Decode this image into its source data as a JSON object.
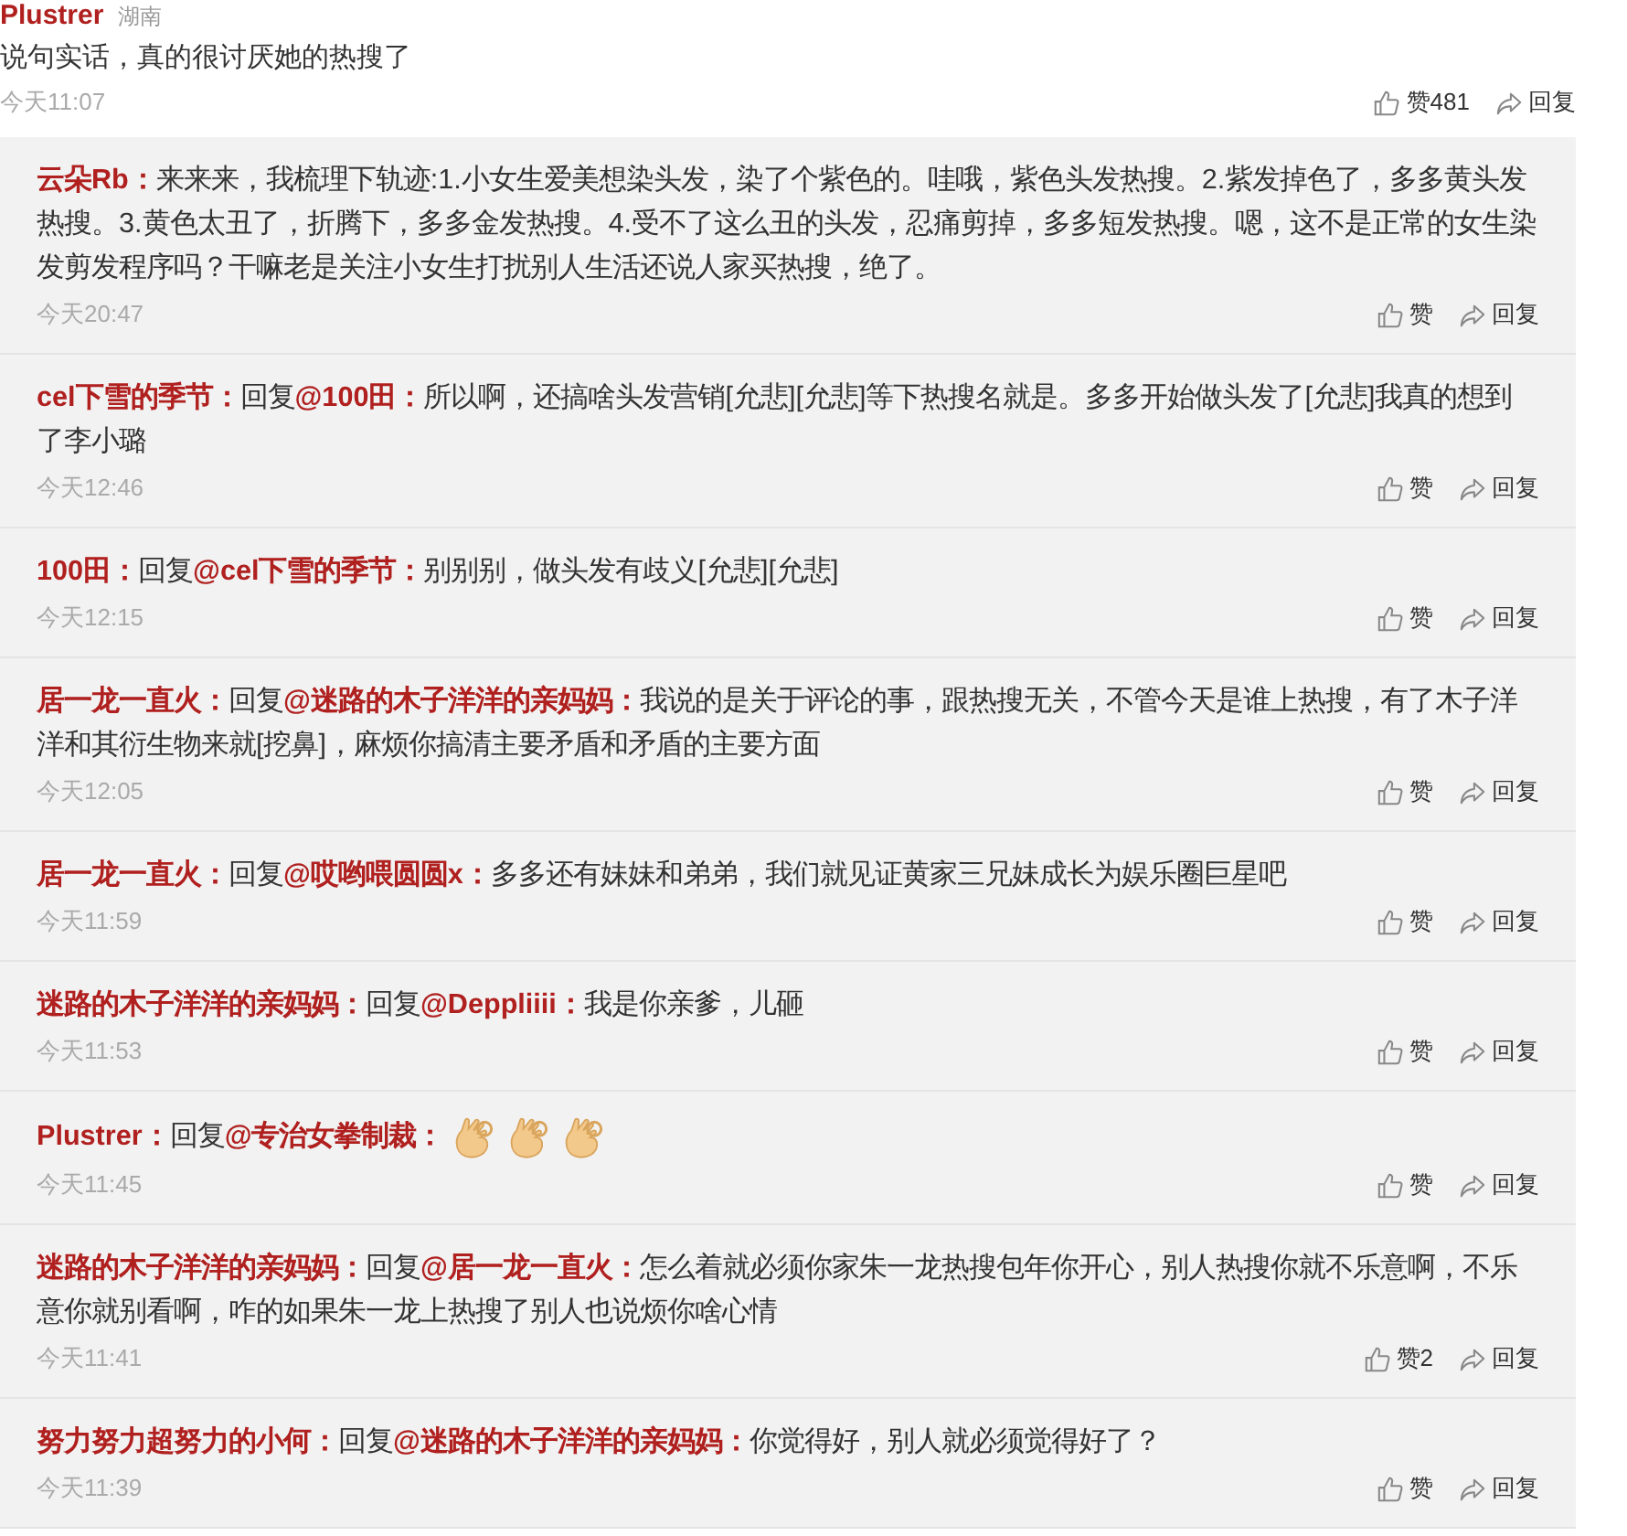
{
  "main_comment": {
    "author": "Plustrer",
    "location": "湖南",
    "text": "说句实话，真的很讨厌她的热搜了",
    "time": "今天11:07",
    "like_label": "赞481",
    "reply_label": "回复"
  },
  "replies": [
    {
      "text": "**云朵Rb：**来来来，我梳理下轨迹:1.小女生爱美想染头发，染了个紫色的。哇哦，紫色头发热搜。2.紫发掉色了，多多黄头发热搜。3.黄色太丑了，折腾下，多多金发热搜。4.受不了这么丑的头发，忍痛剪掉，多多短发热搜。嗯，这不是正常的女生染发剪发程序吗？干嘛老是关注小女生打扰别人生活还说人家买热搜，绝了。",
      "time": "今天20:47",
      "like_label": "赞",
      "reply_label": "回复"
    },
    {
      "text": "**cel下雪的季节：**回复**@100田：**所以啊，还搞啥头发营销[允悲][允悲]等下热搜名就是。多多开始做头发了[允悲]我真的想到了李小璐",
      "time": "今天12:46",
      "like_label": "赞",
      "reply_label": "回复"
    },
    {
      "text": "**100田：**回复**@cel下雪的季节：**别别别，做头发有歧义[允悲][允悲]",
      "time": "今天12:15",
      "like_label": "赞",
      "reply_label": "回复"
    },
    {
      "text": "**居一龙一直火：**回复**@迷路的木子洋洋的亲妈妈：**我说的是关于评论的事，跟热搜无关，不管今天是谁上热搜，有了木子洋洋和其衍生物来就[挖鼻]，麻烦你搞清主要矛盾和矛盾的主要方面",
      "time": "今天12:05",
      "like_label": "赞",
      "reply_label": "回复"
    },
    {
      "text": "**居一龙一直火：**回复**@哎哟喂圆圆x：**多多还有妹妹和弟弟，我们就见证黄家三兄妹成长为娱乐圈巨星吧",
      "time": "今天11:59",
      "like_label": "赞",
      "reply_label": "回复"
    },
    {
      "text": "**迷路的木子洋洋的亲妈妈：**回复**@Deppliiii：**我是你亲爹，儿砸",
      "time": "今天11:53",
      "like_label": "赞",
      "reply_label": "回复"
    },
    {
      "text": "**Plustrer：**回复**@专治女拳制裁：**",
      "emojis": [
        {
          "kind": "ok-hand"
        },
        {
          "kind": "ok-hand"
        },
        {
          "kind": "ok-hand"
        }
      ],
      "time": "今天11:45",
      "like_label": "赞",
      "reply_label": "回复"
    },
    {
      "text": "**迷路的木子洋洋的亲妈妈：**回复**@居一龙一直火：**怎么着就必须你家朱一龙热搜包年你开心，别人热搜你就不乐意啊，不乐意你就别看啊，咋的如果朱一龙上热搜了别人也说烦你啥心情",
      "time": "今天11:41",
      "like_label": "赞2",
      "reply_label": "回复"
    },
    {
      "text": "**努力努力超努力的小何：**回复**@迷路的木子洋洋的亲妈妈：**你觉得好，别人就必须觉得好了？",
      "time": "今天11:39",
      "like_label": "赞",
      "reply_label": "回复"
    }
  ]
}
